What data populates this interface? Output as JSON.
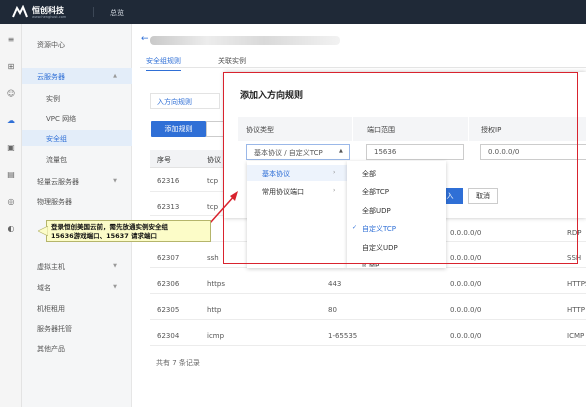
{
  "topbar": {
    "logo_text": "恒创科技",
    "logo_sub": "www.henghost.com",
    "nav_link": "总览"
  },
  "sidebar": {
    "items": [
      {
        "label": "资源中心"
      },
      {
        "label": "云服务器"
      },
      {
        "label": "实例"
      },
      {
        "label": "VPC 网络"
      },
      {
        "label": "安全组"
      },
      {
        "label": "流量包"
      },
      {
        "label": "轻量云服务器"
      },
      {
        "label": "物理服务器"
      },
      {
        "label": "虚拟主机"
      },
      {
        "label": "域名"
      },
      {
        "label": "机柜租用"
      },
      {
        "label": "服务器托管"
      },
      {
        "label": "其他产品"
      }
    ]
  },
  "page": {
    "tabs": [
      {
        "label": "安全组规则"
      },
      {
        "label": "关联实例"
      }
    ],
    "subtab": "入方向规则",
    "add_button": "添加规则"
  },
  "table": {
    "headers": [
      "序号",
      "协议"
    ],
    "rows": [
      {
        "id": "62316",
        "proto": "tcp",
        "port": "",
        "src": "",
        "end": ""
      },
      {
        "id": "62313",
        "proto": "tcp",
        "port": "",
        "src": "",
        "end": ""
      },
      {
        "id": "",
        "proto": "",
        "port": "",
        "src": "0.0.0.0/0",
        "end": "RDP"
      },
      {
        "id": "62307",
        "proto": "ssh",
        "port": "",
        "src": "0.0.0.0/0",
        "end": "SSH"
      },
      {
        "id": "62306",
        "proto": "https",
        "port": "443",
        "src": "0.0.0.0/0",
        "end": "HTTPS"
      },
      {
        "id": "62305",
        "proto": "http",
        "port": "80",
        "src": "0.0.0.0/0",
        "end": "HTTP"
      },
      {
        "id": "62304",
        "proto": "icmp",
        "port": "1-65535",
        "src": "0.0.0.0/0",
        "end": "ICMP"
      }
    ],
    "footer": "共有 7 条记录"
  },
  "modal": {
    "title": "添加入方向规则",
    "headers": [
      "协议类型",
      "端口范围",
      "授权IP"
    ],
    "protocol_value": "基本协议 / 自定义TCP",
    "port_value": "15636",
    "ip_value": "0.0.0.0/0",
    "ok_label": "入",
    "cancel_label": "取消"
  },
  "dropdown": {
    "left": [
      {
        "label": "基本协议"
      },
      {
        "label": "常用协议端口"
      }
    ],
    "right": [
      {
        "label": "全部"
      },
      {
        "label": "全部TCP"
      },
      {
        "label": "全部UDP"
      },
      {
        "label": "自定义TCP"
      },
      {
        "label": "自定义UDP"
      },
      {
        "label": "ICMP"
      }
    ]
  },
  "callout": {
    "line1": "登录恒创美国云前，需先放通实例安全组",
    "line2": "15636游戏端口、15637 请求端口"
  },
  "colors": {
    "accent": "#2f6fd6",
    "topbar": "#1f2937",
    "annotation_red": "#d9232e",
    "note_bg": "#fcfcc8"
  }
}
